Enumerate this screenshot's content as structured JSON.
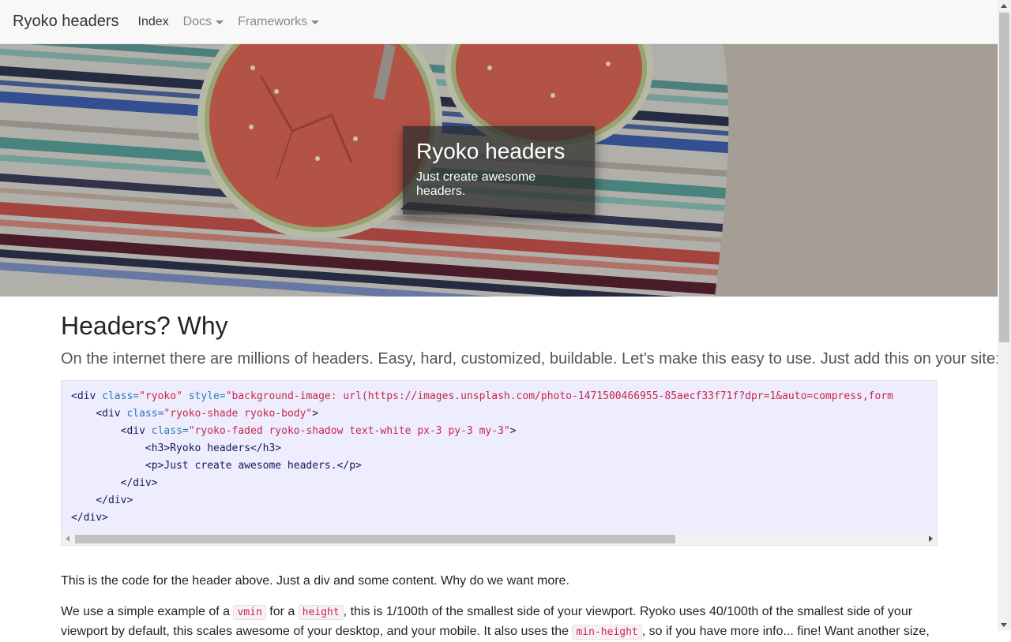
{
  "nav": {
    "brand": "Ryoko headers",
    "items": [
      {
        "label": "Index"
      },
      {
        "label": "Docs"
      },
      {
        "label": "Frameworks"
      }
    ]
  },
  "hero": {
    "title": "Ryoko headers",
    "subtitle": "Just create awesome headers."
  },
  "main": {
    "heading": "Headers? Why",
    "lead": "On the internet there are millions of headers. Easy, hard, customized, buildable. Let's make this easy to use. Just add this on your site:",
    "code": {
      "line1_tag": "<div ",
      "line1_attr1": "class=",
      "line1_val1": "\"ryoko\"",
      "line1_attr2": " style=",
      "line1_val2": "\"background-image: url(https://images.unsplash.com/photo-1471500466955-85aecf33f71f?dpr=1&auto=compress,form",
      "line2_tag": "<div ",
      "line2_attr": "class=",
      "line2_val": "\"ryoko-shade ryoko-body\"",
      "line2_end": ">",
      "line3_tag": "<div ",
      "line3_attr": "class=",
      "line3_val": "\"ryoko-faded ryoko-shadow text-white px-3 py-3 my-3\"",
      "line3_end": ">",
      "line4": "<h3>Ryoko headers</h3>",
      "line5": "<p>Just create awesome headers.</p>",
      "line6": "</div>",
      "line7": "</div>",
      "line8": "</div>"
    },
    "para1": "This is the code for the header above. Just a div and some content. Why do we want more.",
    "para2": {
      "t1": "We use a simple example of a ",
      "c1": "vmin",
      "t2": " for a ",
      "c2": "height",
      "t3": ", this is 1/100th of the smallest side of your viewport. Ryoko uses 40/100th of the smallest side of your viewport by default, this scales awesome of your desktop, and your mobile. It also uses the ",
      "c3": "min-height",
      "t4": ", so if you have more info... fine! Want another size,"
    }
  },
  "colors": {
    "nav_bg": "#f8f8f8",
    "code_bg": "#eeedfd",
    "inline_code": "#c7254e"
  }
}
